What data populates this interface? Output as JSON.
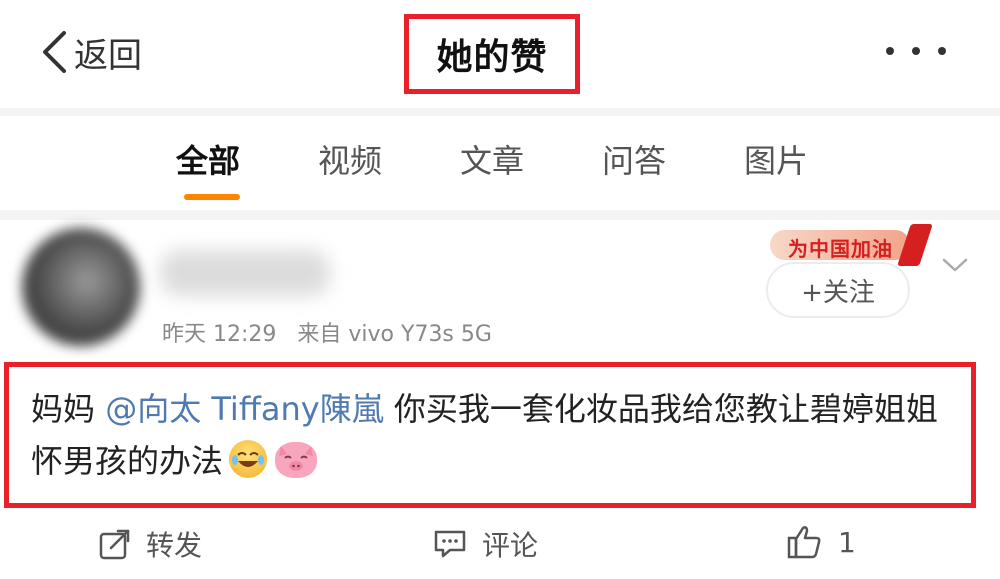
{
  "header": {
    "back_label": "返回",
    "title": "她的赞"
  },
  "tabs": [
    {
      "label": "全部",
      "active": true
    },
    {
      "label": "视频",
      "active": false
    },
    {
      "label": "文章",
      "active": false
    },
    {
      "label": "问答",
      "active": false
    },
    {
      "label": "图片",
      "active": false
    }
  ],
  "post": {
    "meta": {
      "time": "昨天 12:29",
      "source": "来自 vivo Y73s 5G"
    },
    "badge_text": "为中国加油",
    "follow_label": "+关注",
    "content": {
      "prefix": "妈妈 ",
      "mention": "@向太 Tiffany陳嵐",
      "text": " 你买我一套化妆品我给您教让碧婷姐姐怀男孩的办法"
    },
    "emojis": [
      "laugh-cry-emoji",
      "pig-emoji"
    ],
    "actions": {
      "repost_label": "转发",
      "comment_label": "评论",
      "like_count": "1"
    }
  },
  "colors": {
    "accent": "#ff8200",
    "highlight_box": "#e8202a",
    "mention": "#4f7ab0"
  }
}
